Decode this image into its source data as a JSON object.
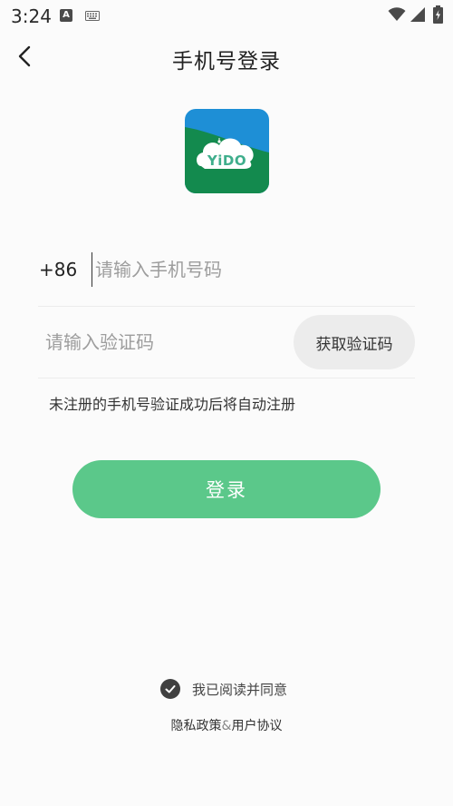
{
  "status_bar": {
    "time": "3:24",
    "notification_a": "A"
  },
  "header": {
    "title": "手机号登录"
  },
  "logo": {
    "text": "YiDO"
  },
  "form": {
    "country_code": "+86",
    "phone_placeholder": "请输入手机号码",
    "code_placeholder": "请输入验证码",
    "get_code_label": "获取验证码",
    "register_hint": "未注册的手机号验证成功后将自动注册",
    "login_label": "登录"
  },
  "agreement": {
    "checked": true,
    "label": "我已阅读并同意",
    "privacy_policy": "隐私政策",
    "separator": "&",
    "user_agreement": "用户协议"
  },
  "colors": {
    "primary_green": "#5bc88a",
    "logo_blue": "#1e8fd6",
    "logo_green": "#138a4e",
    "button_gray": "#ececec"
  }
}
